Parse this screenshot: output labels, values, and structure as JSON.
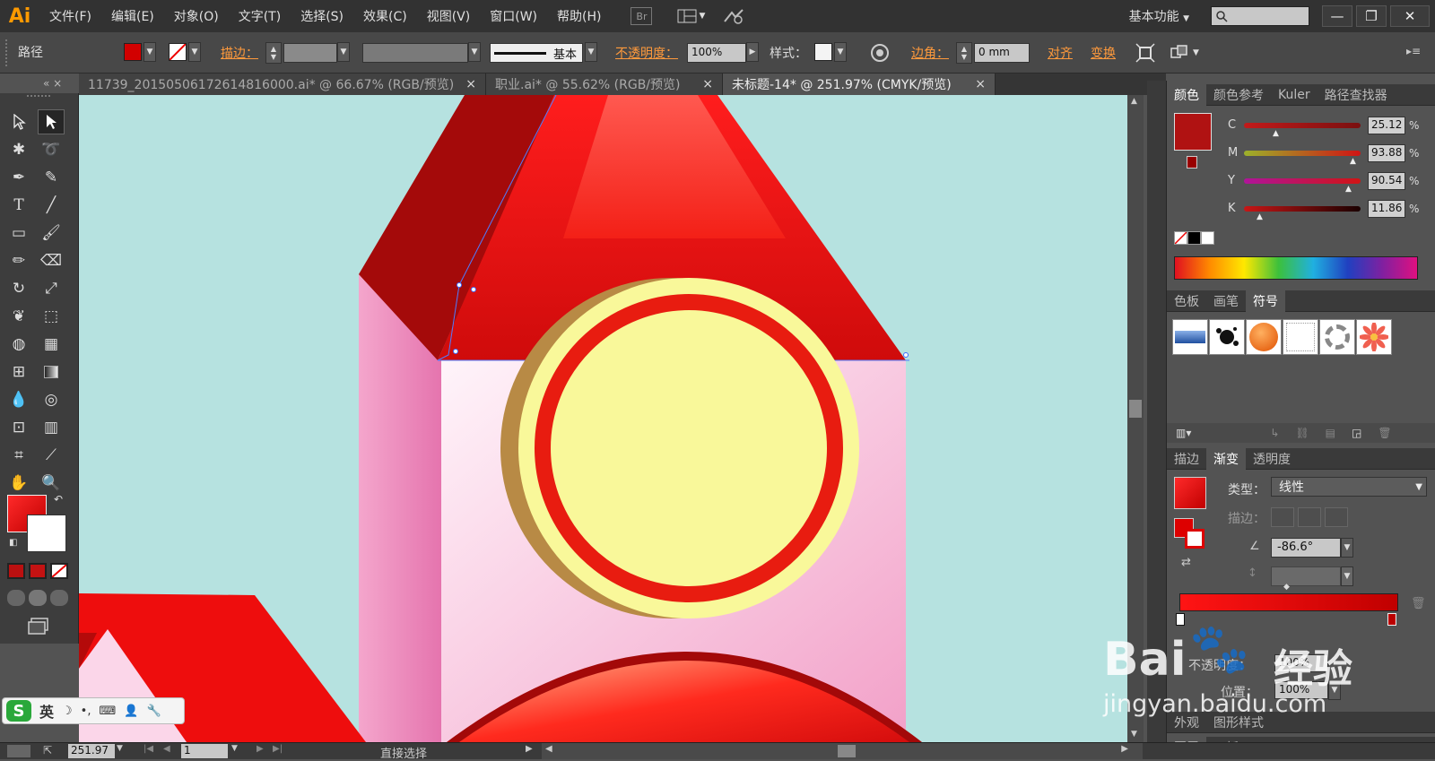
{
  "app": {
    "logo": "Ai",
    "workspace": "基本功能"
  },
  "menu": [
    "文件(F)",
    "编辑(E)",
    "对象(O)",
    "文字(T)",
    "选择(S)",
    "效果(C)",
    "视图(V)",
    "窗口(W)",
    "帮助(H)"
  ],
  "menu_extra": {
    "bridge": "Br"
  },
  "window": {
    "minimize": "—",
    "restore": "❐",
    "close": "✕"
  },
  "control": {
    "object_type": "路径",
    "stroke_label": "描边：",
    "brush_profile": "基本",
    "opacity_label": "不透明度：",
    "opacity_value": "100%",
    "style_label": "样式：",
    "corner_label": "边角：",
    "corner_value": "0 mm",
    "align_label": "对齐",
    "transform_label": "变换"
  },
  "tabs": [
    {
      "label": "11739_20150506172614816000.ai* @ 66.67% (RGB/预览)",
      "close": "×"
    },
    {
      "label": "职业.ai* @ 55.62% (RGB/预览)",
      "close": "×"
    },
    {
      "label": "未标题-14* @ 251.97% (CMYK/预览)",
      "close": "×"
    }
  ],
  "tabbar_ctrl": "«  ×",
  "color_panel": {
    "tabs": [
      "颜色",
      "颜色参考",
      "Kuler",
      "路径查找器"
    ],
    "channels": [
      {
        "name": "C",
        "value": "25.12",
        "pct": 0.25
      },
      {
        "name": "M",
        "value": "93.88",
        "pct": 0.94
      },
      {
        "name": "Y",
        "value": "90.54",
        "pct": 0.9
      },
      {
        "name": "K",
        "value": "11.86",
        "pct": 0.12
      }
    ],
    "unit": "%",
    "fill_color": "#b01212"
  },
  "symbols_panel": {
    "tabs": [
      "色板",
      "画笔",
      "符号"
    ]
  },
  "gradient_panel": {
    "tabs": [
      "描边",
      "渐变",
      "透明度"
    ],
    "type_label": "类型：",
    "type_value": "线性",
    "stroke_label": "描边：",
    "angle_value": "-86.6°",
    "opacity_label": "不透明度：",
    "opacity_value": "100%",
    "position_label": "位置：",
    "position_value": "100%"
  },
  "appearance_panel": {
    "tabs": [
      "外观",
      "图形样式"
    ]
  },
  "layers_panel": {
    "tabs": [
      "图层",
      "画板"
    ]
  },
  "status": {
    "zoom": "251.97",
    "artboard": "1",
    "tool": "直接选择"
  },
  "ime": {
    "logo": "S",
    "lang": "英"
  },
  "watermark": {
    "brand": "Bai",
    "brand2": "经验",
    "url": "jingyan.baidu.com"
  },
  "colors": {
    "accent": "#ff9a3c",
    "bg": "#535353"
  }
}
